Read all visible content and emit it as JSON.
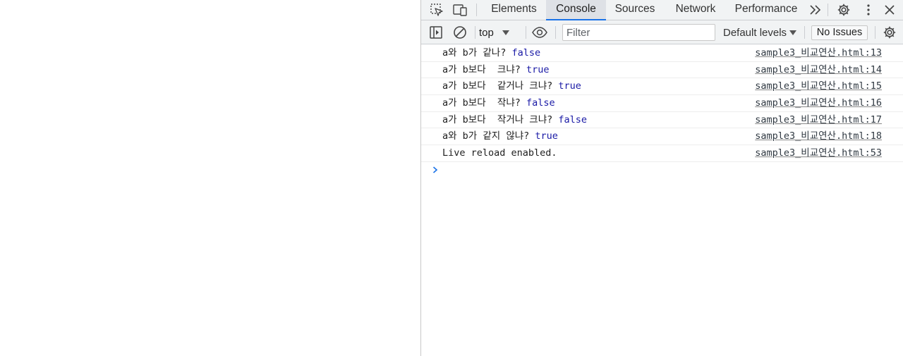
{
  "tabs": [
    {
      "label": "Elements",
      "active": false
    },
    {
      "label": "Console",
      "active": true
    },
    {
      "label": "Sources",
      "active": false
    },
    {
      "label": "Network",
      "active": false
    },
    {
      "label": "Performance",
      "active": false
    }
  ],
  "toolbar": {
    "context": "top",
    "filter_placeholder": "Filter",
    "filter_value": "",
    "levels_label": "Default levels",
    "issues_label": "No Issues"
  },
  "messages": [
    {
      "text": "a와 b가 같나? ",
      "value": "false",
      "source": "sample3_비교연산.html:13"
    },
    {
      "text": "a가 b보다  크냐? ",
      "value": "true",
      "source": "sample3_비교연산.html:14"
    },
    {
      "text": "a가 b보다  같거나 크냐? ",
      "value": "true",
      "source": "sample3_비교연산.html:15"
    },
    {
      "text": "a가 b보다  작냐? ",
      "value": "false",
      "source": "sample3_비교연산.html:16"
    },
    {
      "text": "a가 b보다  작거나 크냐? ",
      "value": "false",
      "source": "sample3_비교연산.html:17"
    },
    {
      "text": "a와 b가 같지 않냐? ",
      "value": "true",
      "source": "sample3_비교연산.html:18"
    },
    {
      "text": "Live reload enabled.",
      "value": "",
      "source": "sample3_비교연산.html:53"
    }
  ],
  "colors": {
    "accent": "#1a73e8",
    "value_text": "#1a1aa6",
    "toolbar_bg": "#f1f3f4"
  }
}
